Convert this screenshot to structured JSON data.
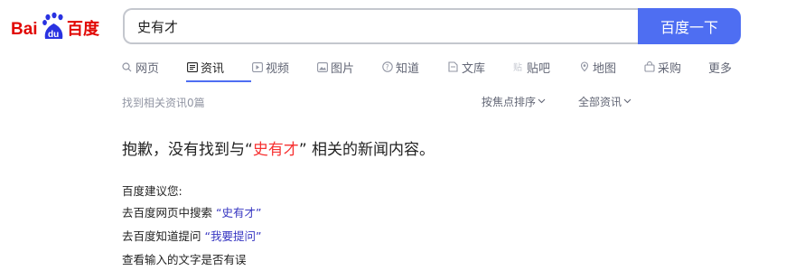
{
  "logo": {
    "text_left": "Bai",
    "text_mid": "du",
    "text_right": "百度"
  },
  "search": {
    "value": "史有才",
    "button_label": "百度一下"
  },
  "tabs": [
    {
      "label": "网页",
      "icon": "search-icon"
    },
    {
      "label": "资讯",
      "icon": "news-icon",
      "active": true
    },
    {
      "label": "视频",
      "icon": "video-icon"
    },
    {
      "label": "图片",
      "icon": "image-icon"
    },
    {
      "label": "知道",
      "icon": "question-icon"
    },
    {
      "label": "文库",
      "icon": "document-icon"
    },
    {
      "label": "贴吧",
      "icon": "tieba-icon"
    },
    {
      "label": "地图",
      "icon": "map-icon"
    },
    {
      "label": "采购",
      "icon": "purchase-icon"
    },
    {
      "label": "更多",
      "icon": ""
    }
  ],
  "results": {
    "count_text": "找到相关资讯0篇",
    "sort_label": "按焦点排序",
    "scope_label": "全部资讯"
  },
  "no_result": {
    "prefix": "抱歉，没有找到与“",
    "keyword": "史有才",
    "suffix": "” 相关的新闻内容。"
  },
  "suggestions": {
    "heading": "百度建议您:",
    "line1_prefix": "去百度网页中搜索 ",
    "line1_link": "“史有才”",
    "line2_prefix": "去百度知道提问 ",
    "line2_link": "“我要提问”",
    "line3": "查看输入的文字是否有误"
  },
  "colors": {
    "accent": "#4e6ef2",
    "keyword": "#f73131",
    "link": "#3837c2"
  }
}
